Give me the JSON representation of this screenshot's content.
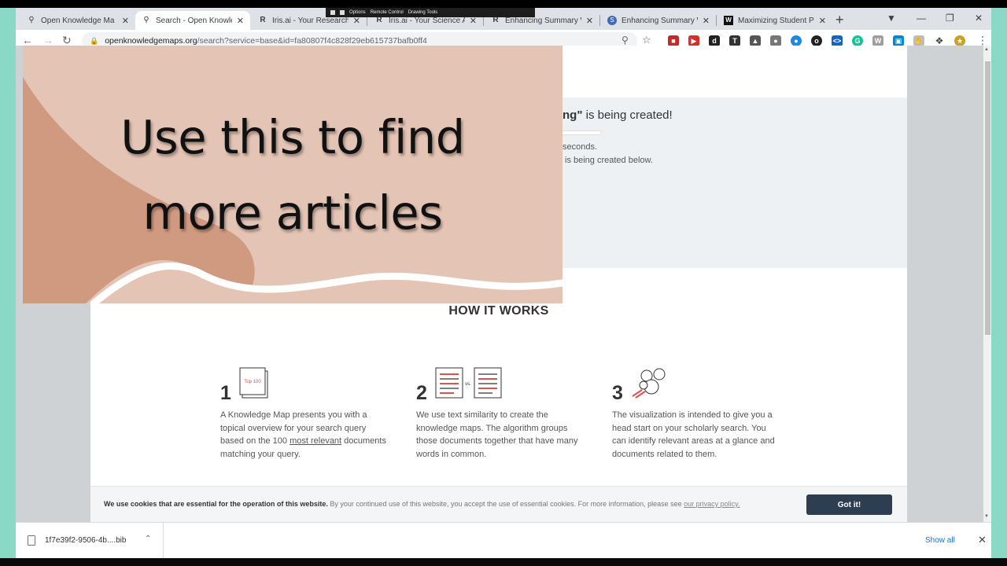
{
  "remote_control": {
    "options": "Options",
    "remote": "Remote Control",
    "drawing": "Drawing Tools"
  },
  "tabs": [
    {
      "title": "Open Knowledge Ma",
      "icon": "pin-icon"
    },
    {
      "title": "Search - Open Knowle",
      "icon": "pin-icon"
    },
    {
      "title": "Iris.ai - Your Research",
      "icon": "R"
    },
    {
      "title": "Iris.ai - Your Science A",
      "icon": "R"
    },
    {
      "title": "Enhancing Summary W",
      "icon": "R"
    },
    {
      "title": "Enhancing Summary W",
      "icon": "S"
    },
    {
      "title": "Maximizing Student P",
      "icon": "W"
    }
  ],
  "address": {
    "domain": "openknowledgemaps.org",
    "path": "/search?service=base&id=fa80807f4c828f29eb615737bafb0ff4"
  },
  "progress": {
    "title_bold": "ng\"",
    "title_rest": " is being created!",
    "line1": "seconds.",
    "line2": "is being created below."
  },
  "how_it_works": {
    "heading": "HOW IT WORKS",
    "steps": [
      {
        "num": "1",
        "badge": "Top 100",
        "text_a": "A Knowledge Map presents you with a topical overview for your search query based on the 100 ",
        "link": "most relevant",
        "text_b": " documents matching your query."
      },
      {
        "num": "2",
        "badge": "vs.",
        "text_a": "We use text similarity to create the knowledge maps. The algorithm groups those documents together that have many words in common.",
        "link": "",
        "text_b": ""
      },
      {
        "num": "3",
        "badge": "",
        "text_a": "The visualization is intended to give you a head start on your scholarly search. You can identify relevant areas at a glance and documents related to them.",
        "link": "",
        "text_b": ""
      }
    ]
  },
  "cookie": {
    "bold": "We use cookies that are essential for the operation of this website.",
    "text": " By your continued use of this website, you accept the use of essential cookies. For more information, please see ",
    "link": "our privacy policy.",
    "button": "Got it!"
  },
  "overlay": {
    "line1": "Use this to find",
    "line2": "more articles"
  },
  "downloads": {
    "file": "1f7e39f2-9506-4b....bib",
    "show_all": "Show all"
  },
  "colors": {
    "frame": "#8ad8c6",
    "overlay_bg": "#e4c4b5",
    "overlay_blob": "#d09a80",
    "button": "#2d3e50"
  }
}
